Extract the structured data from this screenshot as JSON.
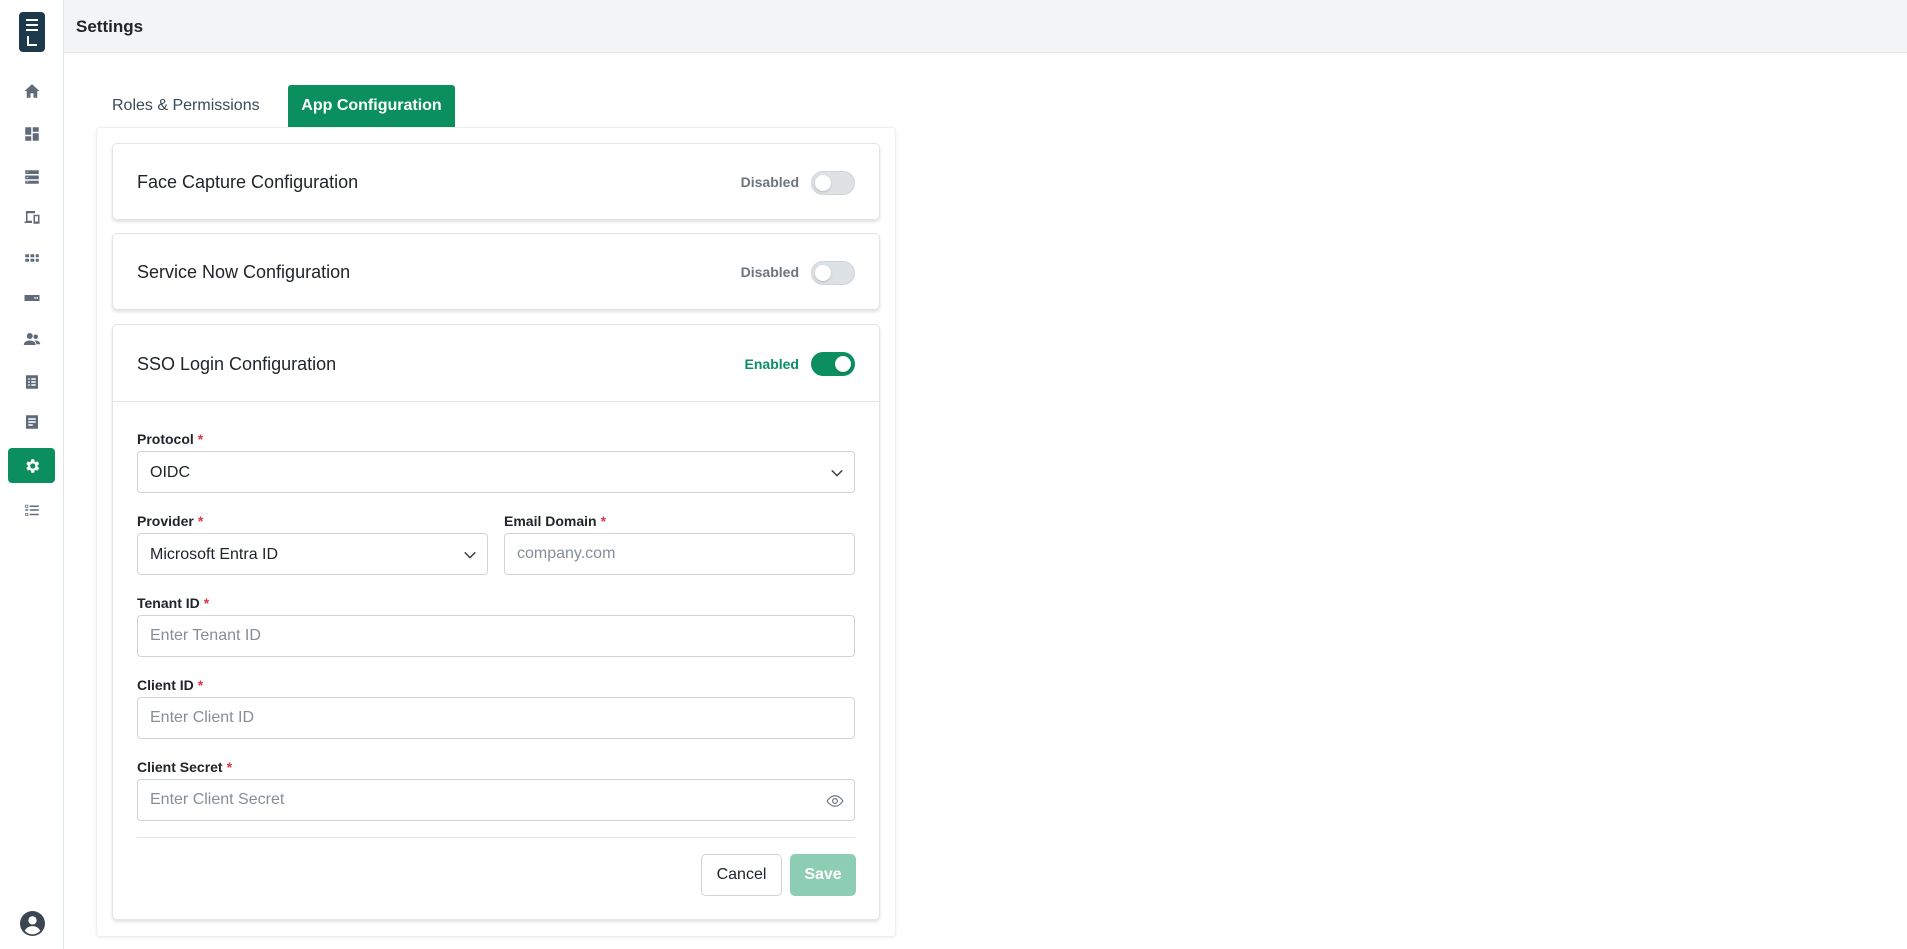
{
  "header": {
    "title": "Settings"
  },
  "sidebar": {
    "items": [
      {
        "icon": "home-icon"
      },
      {
        "icon": "dashboard-icon"
      },
      {
        "icon": "server-icon"
      },
      {
        "icon": "devices-icon"
      },
      {
        "icon": "apps-grid-icon"
      },
      {
        "icon": "storage-icon"
      },
      {
        "icon": "users-icon"
      },
      {
        "icon": "list-icon"
      },
      {
        "icon": "document-icon"
      },
      {
        "icon": "gear-icon",
        "active": true
      },
      {
        "icon": "checklist-icon"
      }
    ],
    "avatar_icon": "user-circle-icon"
  },
  "tabs": [
    {
      "label": "Roles & Permissions",
      "active": false
    },
    {
      "label": "App Configuration",
      "active": true
    }
  ],
  "cards": {
    "face_capture": {
      "title": "Face Capture Configuration",
      "status": "Disabled",
      "enabled": false
    },
    "service_now": {
      "title": "Service Now Configuration",
      "status": "Disabled",
      "enabled": false
    },
    "sso": {
      "title": "SSO Login Configuration",
      "status": "Enabled",
      "enabled": true,
      "form": {
        "protocol": {
          "label": "Protocol",
          "value": "OIDC"
        },
        "provider": {
          "label": "Provider",
          "value": "Microsoft Entra ID"
        },
        "email_domain": {
          "label": "Email Domain",
          "placeholder": "company.com",
          "value": ""
        },
        "tenant_id": {
          "label": "Tenant ID",
          "placeholder": "Enter Tenant ID",
          "value": ""
        },
        "client_id": {
          "label": "Client ID",
          "placeholder": "Enter Client ID",
          "value": ""
        },
        "client_secret": {
          "label": "Client Secret",
          "placeholder": "Enter Client Secret",
          "value": ""
        },
        "required_mark": "*"
      },
      "actions": {
        "cancel": "Cancel",
        "save": "Save"
      }
    }
  },
  "colors": {
    "accent": "#0b8f5f",
    "save_disabled": "#8dcdb4",
    "required": "#dc3545"
  }
}
